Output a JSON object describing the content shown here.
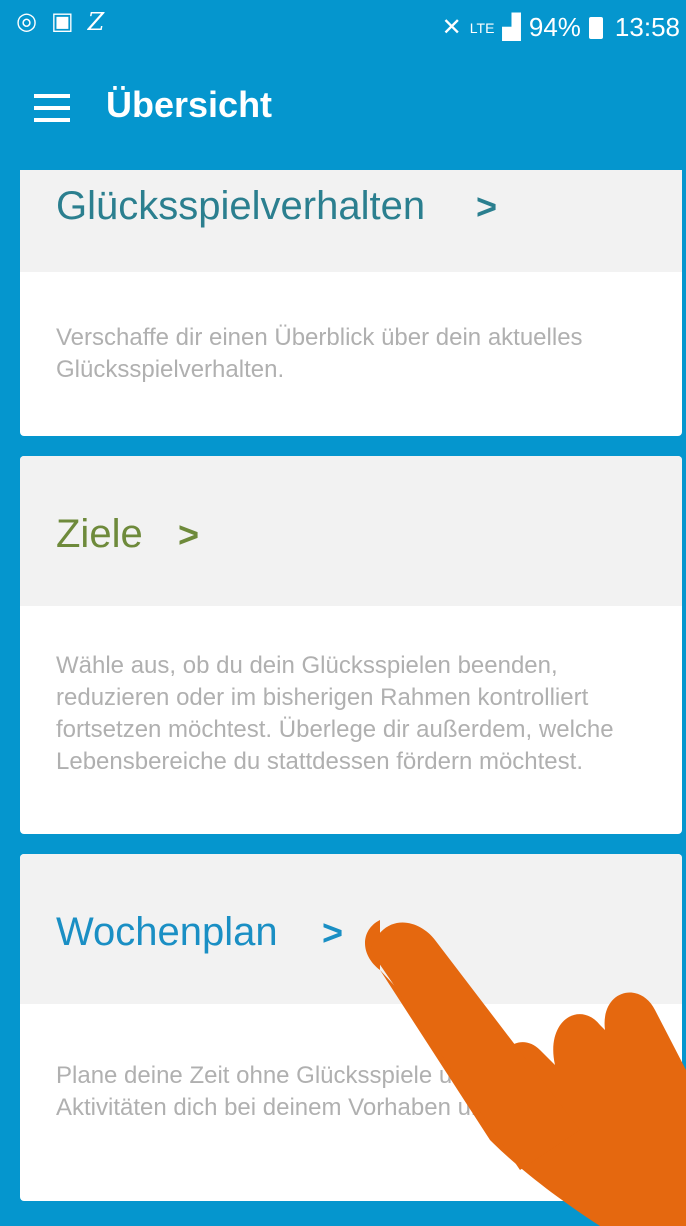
{
  "status": {
    "left_icons": [
      "target-icon",
      "screen-icon",
      "z-icon"
    ],
    "battery": "94%",
    "time": "13:58",
    "network": "LTE"
  },
  "appbar": {
    "title": "Übersicht",
    "menu_icon": "hamburger-icon"
  },
  "cards": [
    {
      "title": "Glücksspielverhalten",
      "chevron": ">",
      "color": "#2b7f8f",
      "description": "Verschaffe dir einen Überblick über dein aktuelles Glücksspielverhalten."
    },
    {
      "title": "Ziele",
      "chevron": ">",
      "color": "#6e8a3b",
      "description": "Wähle aus, ob du dein Glücksspielen beenden, reduzieren oder im bisherigen Rahmen kontrolliert fortsetzen möchtest. Überlege dir außerdem, welche Lebensbereiche du stattdessen fördern möchtest."
    },
    {
      "title": "Wochenplan",
      "chevron": ">",
      "color": "#1a8fc4",
      "description": "Plane deine Zeit ohne Glücksspiele und welche Aktivitäten dich bei deinem Vorhaben unterstützen."
    }
  ],
  "overlay": {
    "icon": "pointing-hand-icon",
    "color": "#e5680f"
  }
}
